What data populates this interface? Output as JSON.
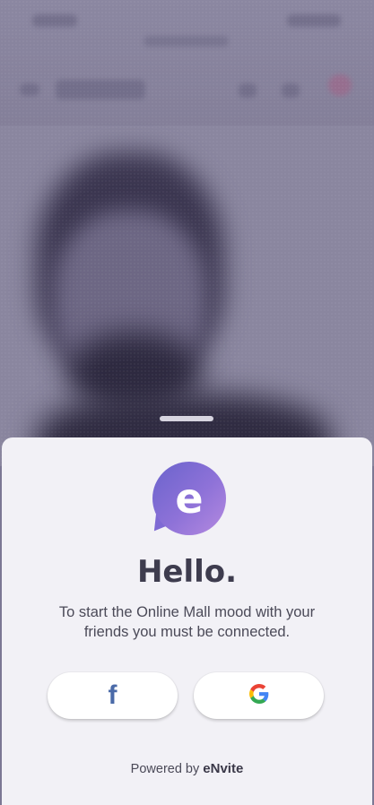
{
  "sheet": {
    "logo_letter": "e",
    "greeting": "Hello.",
    "message": "To start the Online Mall mood with your friends you must be connected.",
    "facebook_icon": "f",
    "powered_by_prefix": "Powered by",
    "powered_by_brand": "eNvite"
  },
  "icons": {
    "facebook": "facebook-icon",
    "google": "google-icon",
    "logo": "envite-logo"
  },
  "colors": {
    "accent": "#7e6bd6",
    "sheet_bg": "#f2f1f6",
    "facebook": "#4a6aa8",
    "google_blue": "#4285F4",
    "google_red": "#EA4335",
    "google_yellow": "#FBBC05",
    "google_green": "#34A853"
  }
}
